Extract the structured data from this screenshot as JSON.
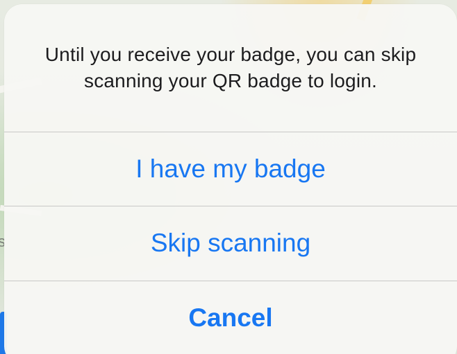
{
  "alert": {
    "message": "Until you receive your badge, you can skip scanning your QR badge to login.",
    "actions": [
      {
        "label": "I have my badge",
        "style": "default"
      },
      {
        "label": "Skip scanning",
        "style": "default"
      },
      {
        "label": "Cancel",
        "style": "cancel"
      }
    ]
  },
  "background": {
    "map_label_fragment": "s"
  },
  "colors": {
    "action_blue": "#1877f2",
    "sheet_bg": "#f7f7f4",
    "divider": "#c8c8c6",
    "text": "#1c1c1e"
  }
}
